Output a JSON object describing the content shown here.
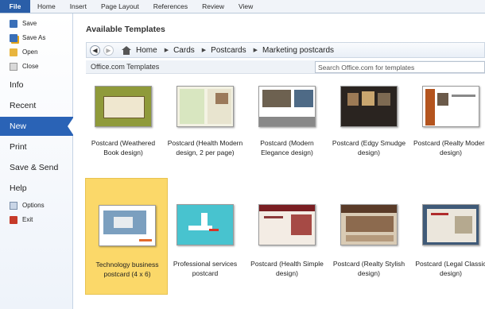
{
  "ribbon": {
    "tabs": [
      "File",
      "Home",
      "Insert",
      "Page Layout",
      "References",
      "Review",
      "View"
    ]
  },
  "backstage": {
    "small_items_top": [
      {
        "label": "Save",
        "icon": "save-icon"
      },
      {
        "label": "Save As",
        "icon": "save-as-icon"
      },
      {
        "label": "Open",
        "icon": "open-icon"
      },
      {
        "label": "Close",
        "icon": "close-icon"
      }
    ],
    "big_items": [
      "Info",
      "Recent",
      "New",
      "Print",
      "Save & Send",
      "Help"
    ],
    "selected": "New",
    "small_items_bottom": [
      {
        "label": "Options",
        "icon": "options-icon"
      },
      {
        "label": "Exit",
        "icon": "exit-icon"
      }
    ]
  },
  "main": {
    "title": "Available Templates",
    "breadcrumb": [
      "Home",
      "Cards",
      "Postcards",
      "Marketing postcards"
    ],
    "source_label": "Office.com Templates",
    "search_placeholder": "Search Office.com for templates",
    "templates_row1": [
      "Postcard (Weathered Book design)",
      "Postcard (Health Modern design, 2 per page)",
      "Postcard (Modern Elegance design)",
      "Postcard (Edgy Smudge design)",
      "Postcard (Realty Modern design)"
    ],
    "templates_row2": [
      "Technology business postcard (4 x 6)",
      "Professional services postcard",
      "Postcard (Health Simple design)",
      "Postcard (Realty Stylish design)",
      "Postcard (Legal Classic design)"
    ],
    "selected_template": "Technology business postcard (4 x 6)"
  },
  "colors": {
    "file_tab": "#2a5ea8",
    "selected_nav": "#2a63b6",
    "selected_template_bg": "#fbd869"
  }
}
